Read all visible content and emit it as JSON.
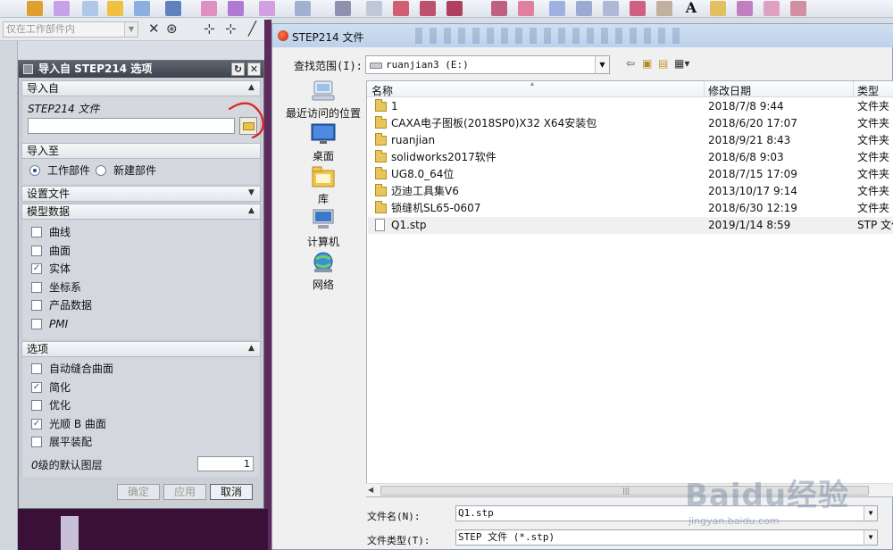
{
  "nx_app": {
    "filter_placeholder": "仅在工作部件内"
  },
  "nx_dialog": {
    "title": "导入自 STEP214 选项",
    "sections": {
      "import_from": {
        "header": "导入自",
        "file_label": "STEP214 文件",
        "file_value": ""
      },
      "import_to": {
        "header": "导入至",
        "options": [
          "工作部件",
          "新建部件"
        ],
        "selected": "工作部件"
      },
      "settings_file": {
        "header": "设置文件"
      },
      "model_data": {
        "header": "模型数据",
        "items": [
          {
            "label": "曲线",
            "checked": false
          },
          {
            "label": "曲面",
            "checked": false
          },
          {
            "label": "实体",
            "checked": true
          },
          {
            "label": "坐标系",
            "checked": false
          },
          {
            "label": "产品数据",
            "checked": false
          },
          {
            "label": "PMI",
            "checked": false
          }
        ]
      },
      "options": {
        "header": "选项",
        "items": [
          {
            "label": "自动缝合曲面",
            "checked": false
          },
          {
            "label": "简化",
            "checked": true
          },
          {
            "label": "优化",
            "checked": false
          },
          {
            "label": "光顺 B 曲面",
            "checked": true
          },
          {
            "label": "展平装配",
            "checked": false
          }
        ],
        "layer_label": "0 级的默认图层",
        "layer_value": "1"
      }
    },
    "buttons": {
      "ok": "确定",
      "apply": "应用",
      "cancel": "取消"
    }
  },
  "file_dialog": {
    "title": "STEP214 文件",
    "look_in_label": "查找范围(I):",
    "look_in_value": "ruanjian3 (E:)",
    "places": [
      {
        "label": "最近访问的位置",
        "icon": "recent-places-icon"
      },
      {
        "label": "桌面",
        "icon": "desktop-icon"
      },
      {
        "label": "库",
        "icon": "libraries-icon"
      },
      {
        "label": "计算机",
        "icon": "computer-icon"
      },
      {
        "label": "网络",
        "icon": "network-icon"
      }
    ],
    "columns": {
      "name": "名称",
      "date": "修改日期",
      "type": "类型"
    },
    "files": [
      {
        "name": "1",
        "date": "2018/7/8 9:44",
        "type": "文件夹",
        "kind": "folder"
      },
      {
        "name": "CAXA电子图板(2018SP0)X32 X64安装包",
        "date": "2018/6/20 17:07",
        "type": "文件夹",
        "kind": "folder"
      },
      {
        "name": "ruanjian",
        "date": "2018/9/21 8:43",
        "type": "文件夹",
        "kind": "folder"
      },
      {
        "name": "solidworks2017软件",
        "date": "2018/6/8 9:03",
        "type": "文件夹",
        "kind": "folder"
      },
      {
        "name": "UG8.0_64位",
        "date": "2018/7/15 17:09",
        "type": "文件夹",
        "kind": "folder"
      },
      {
        "name": "迈迪工具集V6",
        "date": "2013/10/17 9:14",
        "type": "文件夹",
        "kind": "folder"
      },
      {
        "name": "锁缝机SL65-0607",
        "date": "2018/6/30 12:19",
        "type": "文件夹",
        "kind": "folder"
      },
      {
        "name": "Q1.stp",
        "date": "2019/1/14 8:59",
        "type": "STP 文件",
        "kind": "file"
      }
    ],
    "filename_label": "文件名(N):",
    "filename_value": "Q1.stp",
    "filetype_label": "文件类型(T):",
    "filetype_value": "STEP 文件 (*.stp)"
  },
  "watermark": {
    "logo": "Baidu经验",
    "url": "jingyan.baidu.com"
  },
  "colors": {
    "annotation_red": "#e02020",
    "checkbox_blue": "#1e5fbf"
  }
}
